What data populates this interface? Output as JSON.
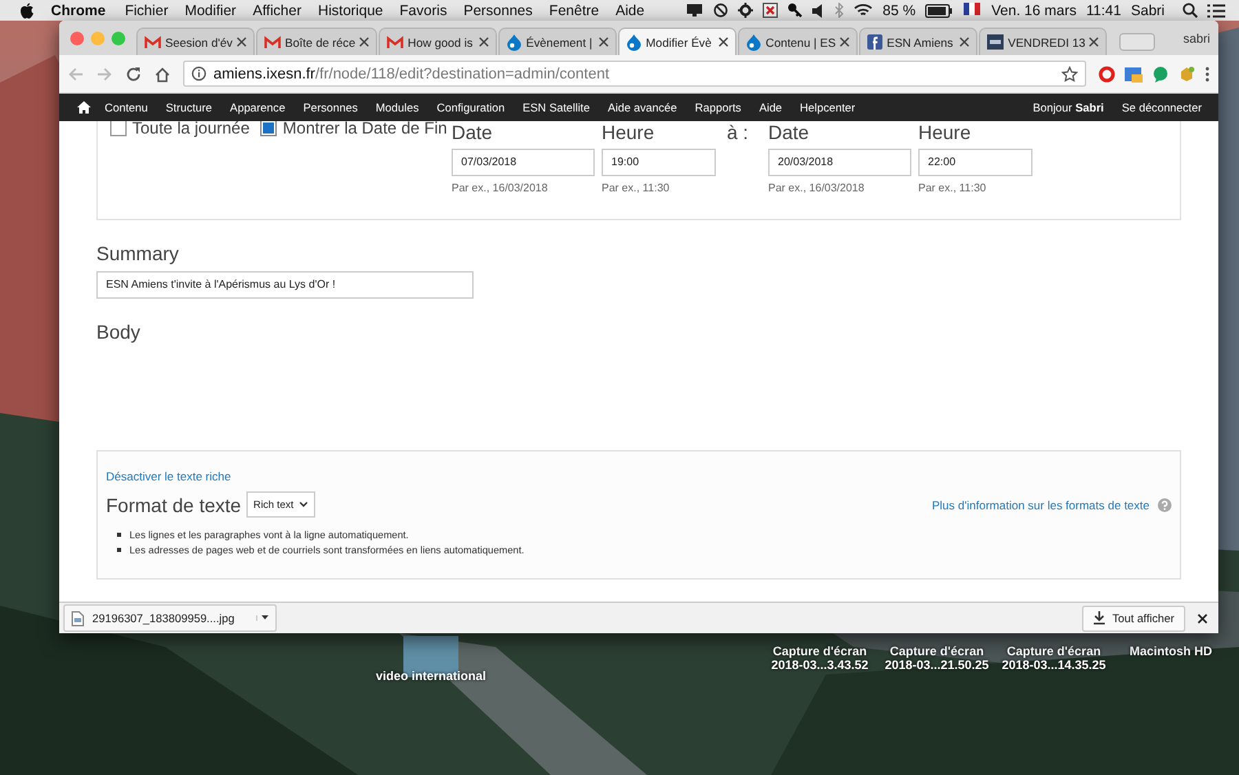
{
  "menu_bar": {
    "app": "Chrome",
    "items": [
      "Fichier",
      "Modifier",
      "Afficher",
      "Historique",
      "Favoris",
      "Personnes",
      "Fenêtre",
      "Aide"
    ],
    "battery": "85 %",
    "date": "Ven. 16 mars",
    "time": "11:41",
    "user": "Sabri"
  },
  "desktop": {
    "icons": [
      {
        "kind": "folder",
        "lines": [
          "video international"
        ]
      },
      {
        "kind": "file",
        "lines": [
          "Capture d'écran",
          "2018-03...3.43.52"
        ]
      },
      {
        "kind": "file",
        "lines": [
          "Capture d'écran",
          "2018-03...21.50.25"
        ]
      },
      {
        "kind": "file",
        "lines": [
          "Capture d'écran",
          "2018-03...14.35.25"
        ]
      },
      {
        "kind": "file",
        "lines": [
          "Macintosh HD"
        ]
      }
    ]
  },
  "browser": {
    "tabs": [
      {
        "kind": "mail",
        "title": "Seesion d'év",
        "selected": false
      },
      {
        "kind": "mail",
        "title": "Boîte de réce",
        "selected": false
      },
      {
        "kind": "mail",
        "title": "How good is",
        "selected": false
      },
      {
        "kind": "drop",
        "title": "Évènement |",
        "selected": false
      },
      {
        "kind": "drop",
        "title": "Modifier Évè",
        "selected": true
      },
      {
        "kind": "drop",
        "title": "Contenu | ES",
        "selected": false
      },
      {
        "kind": "square",
        "title": "ESN Amiens",
        "selected": false
      },
      {
        "kind": "site",
        "title": "VENDREDI 13",
        "selected": false
      }
    ],
    "profile": "sabri",
    "url": {
      "host": "amiens.ixesn.fr",
      "path": "/fr/node/118/edit?destination=admin/content"
    },
    "admin_menu": {
      "items": [
        "Contenu",
        "Structure",
        "Apparence",
        "Personnes",
        "Modules",
        "Configuration",
        "ESN Satellite",
        "Aide avancée",
        "Rapports",
        "Aide",
        "Helpcenter"
      ],
      "greeting": "Bonjour **Sabri**",
      "logout": "Se déconnecter"
    },
    "form": {
      "options": [
        {
          "label": "Toute la journée",
          "checked": false
        },
        {
          "label": "Montrer la Date de Fin",
          "checked": true
        }
      ],
      "start": [
        {
          "kind": "date",
          "label": "Date",
          "value": "07/03/2018",
          "hint": "Par ex., 16/03/2018"
        },
        {
          "kind": "time",
          "label": "Heure",
          "value": "19:00",
          "hint": "Par ex., 11:30"
        }
      ],
      "separator": "à :",
      "end": [
        {
          "kind": "date",
          "label": "Date",
          "value": "20/03/2018",
          "hint": "Par ex., 16/03/2018"
        },
        {
          "kind": "time",
          "label": "Heure",
          "value": "22:00",
          "hint": "Par ex., 11:30"
        }
      ],
      "summary": {
        "label": "Summary",
        "value": "ESN Amiens t'invite à l'Apérismus au Lys d'Or !"
      },
      "body": {
        "label": "Body"
      },
      "text_format": {
        "toggle_link": "Désactiver le texte riche",
        "label": "Format de texte",
        "format": "Rich text",
        "help_link": "Plus d'information sur les formats de texte",
        "tips": [
          "Les lignes et les paragraphes vont à la ligne automatiquement.",
          "Les adresses de pages web et de courriels sont transformées en liens automatiquement."
        ]
      }
    },
    "downloads": {
      "file": "29196307_183809959....jpg",
      "show_all": "Tout afficher"
    }
  }
}
